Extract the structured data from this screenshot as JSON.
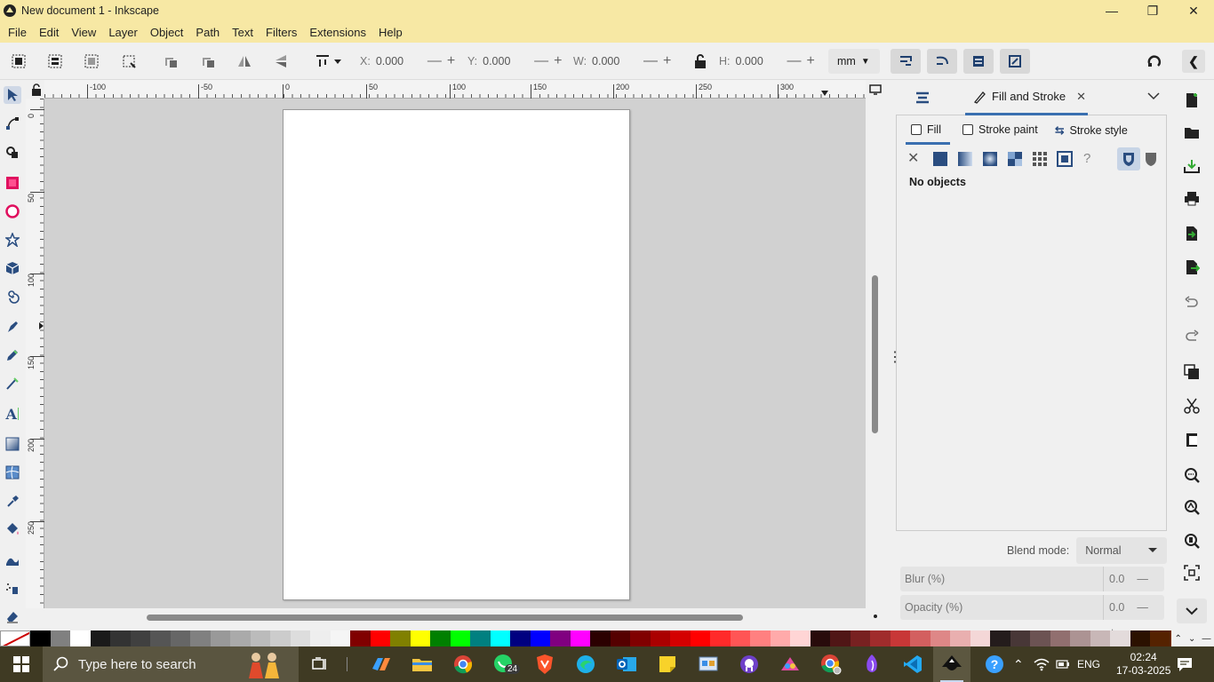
{
  "window": {
    "title": "New document 1 - Inkscape",
    "controls": [
      "—",
      "❐",
      "✕"
    ]
  },
  "menu": [
    "File",
    "Edit",
    "View",
    "Layer",
    "Object",
    "Path",
    "Text",
    "Filters",
    "Extensions",
    "Help"
  ],
  "toolbar": {
    "x_label": "X:",
    "x_value": "0.000",
    "y_label": "Y:",
    "y_value": "0.000",
    "w_label": "W:",
    "w_value": "0.000",
    "h_label": "H:",
    "h_value": "0.000",
    "unit": "mm"
  },
  "rulers": {
    "horizontal": [
      "-100",
      "-50",
      "0",
      "50",
      "100",
      "150",
      "200",
      "250",
      "300"
    ],
    "vertical": [
      "0",
      "50",
      "100",
      "150",
      "200",
      "250"
    ]
  },
  "dock": {
    "tab_label": "Fill and Stroke",
    "fill_tab": "Fill",
    "stroke_paint_tab": "Stroke paint",
    "stroke_style_tab": "Stroke style",
    "status": "No objects",
    "blend_label": "Blend mode:",
    "blend_value": "Normal",
    "blur_label": "Blur (%)",
    "blur_value": "0.0",
    "opacity_label": "Opacity (%)",
    "opacity_value": "0.0"
  },
  "palette": [
    "#000000",
    "#808080",
    "#ffffff",
    "#1a1a1a",
    "#333333",
    "#404040",
    "#555555",
    "#666666",
    "#808080",
    "#999999",
    "#aaaaaa",
    "#bbbbbb",
    "#cccccc",
    "#dddddd",
    "#eeeeee",
    "#f5f5f5",
    "#800000",
    "#ff0000",
    "#808000",
    "#ffff00",
    "#008000",
    "#00ff00",
    "#008080",
    "#00ffff",
    "#000080",
    "#0000ff",
    "#800080",
    "#ff00ff",
    "#2b0000",
    "#550000",
    "#800000",
    "#aa0000",
    "#d40000",
    "#ff0000",
    "#ff2a2a",
    "#ff5555",
    "#ff8080",
    "#ffaaaa",
    "#ffd5d5",
    "#280b0b",
    "#501616",
    "#782121",
    "#a02c2c",
    "#c83737",
    "#d35f5f",
    "#de8787",
    "#e9afaf",
    "#f4d7d7",
    "#241c1c",
    "#483737",
    "#6c5353",
    "#916f6f",
    "#ac9393",
    "#c8b7b7",
    "#e3dbdb",
    "#2b1100",
    "#552200",
    "#803300",
    "#aa4400",
    "#d45500"
  ],
  "taskbar": {
    "search_placeholder": "Type here to search",
    "whatsapp_badge": "24",
    "lang": "ENG",
    "time": "02:24",
    "date": "17-03-2025"
  }
}
